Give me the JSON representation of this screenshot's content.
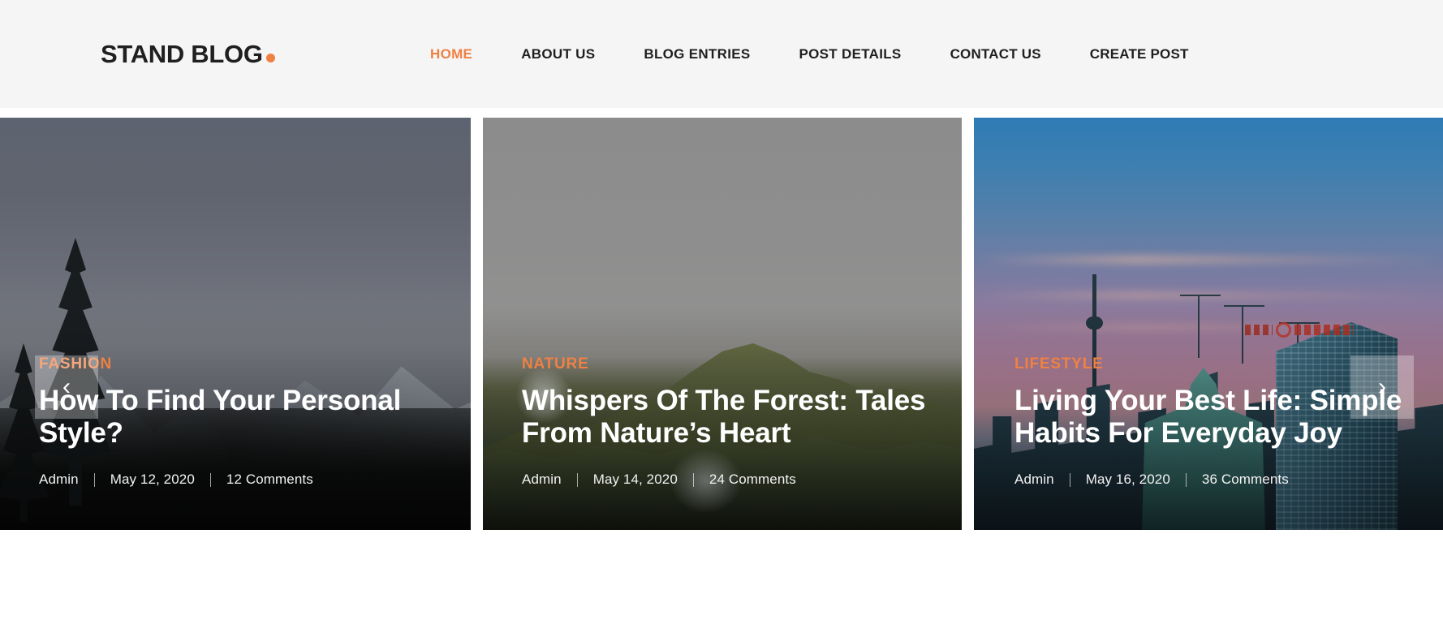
{
  "header": {
    "brand": {
      "text": "STAND BLOG",
      "dot_icon": "dot-icon"
    },
    "nav": [
      {
        "label": "HOME",
        "active": true
      },
      {
        "label": "ABOUT US",
        "active": false
      },
      {
        "label": "BLOG ENTRIES",
        "active": false
      },
      {
        "label": "POST DETAILS",
        "active": false
      },
      {
        "label": "CONTACT US",
        "active": false
      },
      {
        "label": "CREATE POST",
        "active": false
      }
    ]
  },
  "slider": {
    "prev_label": "‹",
    "next_label": "›",
    "prev_icon": "chevron-left-icon",
    "next_icon": "chevron-right-icon",
    "slides": [
      {
        "category": "FASHION",
        "title": "How To Find Your Personal Style?",
        "author": "Admin",
        "date": "May 12, 2020",
        "comments": "12 Comments"
      },
      {
        "category": "NATURE",
        "title": "Whispers Of The Forest: Tales From Nature’s Heart",
        "author": "Admin",
        "date": "May 14, 2020",
        "comments": "24 Comments"
      },
      {
        "category": "LIFESTYLE",
        "title": "Living Your Best Life: Simple Habits For Everyday Joy",
        "author": "Admin",
        "date": "May 16, 2020",
        "comments": "36 Comments"
      }
    ]
  },
  "colors": {
    "accent": "#ef8143",
    "header_bg": "#f5f5f5",
    "text_dark": "#1f1f1f",
    "text_light": "#ffffff"
  }
}
